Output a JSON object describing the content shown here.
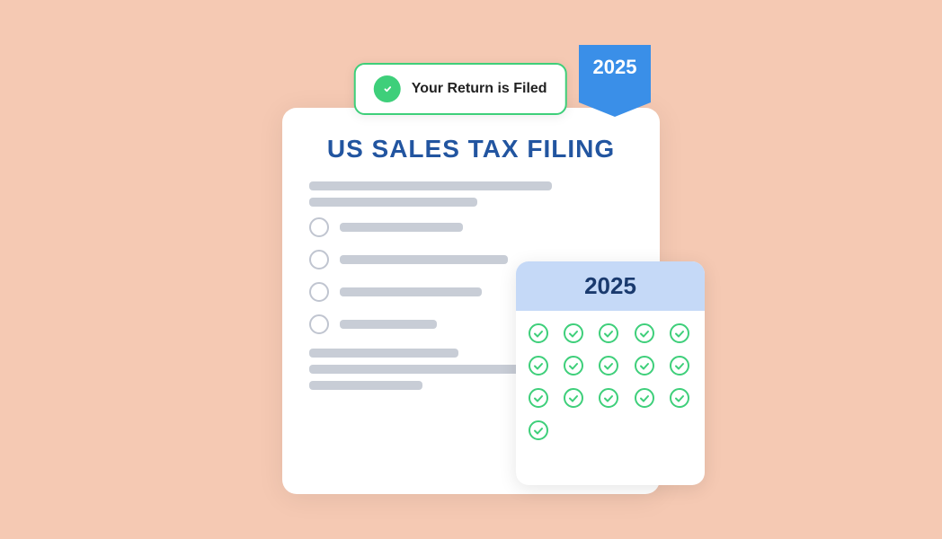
{
  "ribbon": {
    "year": "2025"
  },
  "notification": {
    "label": "Your Return is Filed"
  },
  "document": {
    "title": "US SALES TAX FILING",
    "checklist_items": [
      {
        "line_width": "38%"
      },
      {
        "line_width": "52%"
      },
      {
        "line_width": "44%"
      },
      {
        "line_width": "30%"
      }
    ]
  },
  "calendar": {
    "year": "2025",
    "checked_cells": [
      true,
      true,
      true,
      true,
      true,
      true,
      true,
      true,
      true,
      true,
      true,
      true,
      true,
      true,
      true,
      true,
      false,
      false,
      false,
      false,
      false,
      false,
      false,
      false,
      false
    ]
  }
}
